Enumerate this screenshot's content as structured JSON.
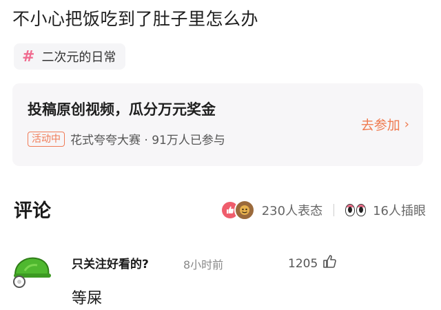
{
  "post": {
    "title": "不小心把饭吃到了肚子里怎么办"
  },
  "topic": {
    "label": "二次元的日常",
    "hash": "#"
  },
  "event": {
    "title": "投稿原创视频，瓜分万元奖金",
    "badge": "活动中",
    "subtitle": "花式夸夸大赛 · 91万人已参与",
    "join_label": "去参加",
    "join_chevron": "›"
  },
  "comments_section": {
    "title": "评论",
    "reactions_count": "230人表态",
    "insert_images_count": "16人插眼"
  },
  "comments": [
    {
      "author": "只关注好看的?",
      "time": "8小时前",
      "likes": "1205",
      "text": "等屎"
    }
  ],
  "colors": {
    "accent": "#ef7a4f",
    "hash": "#f06b8f",
    "like": "#ef5d6c",
    "avatar_green": "#4fb82f"
  },
  "icons": {
    "topic": "hash-icon",
    "like_reaction": "thumbs-up-reaction-icon",
    "face_reaction": "emoji-face-reaction-icon",
    "eyes": "eyes-icon",
    "comment_like": "thumbs-up-outline-icon"
  }
}
